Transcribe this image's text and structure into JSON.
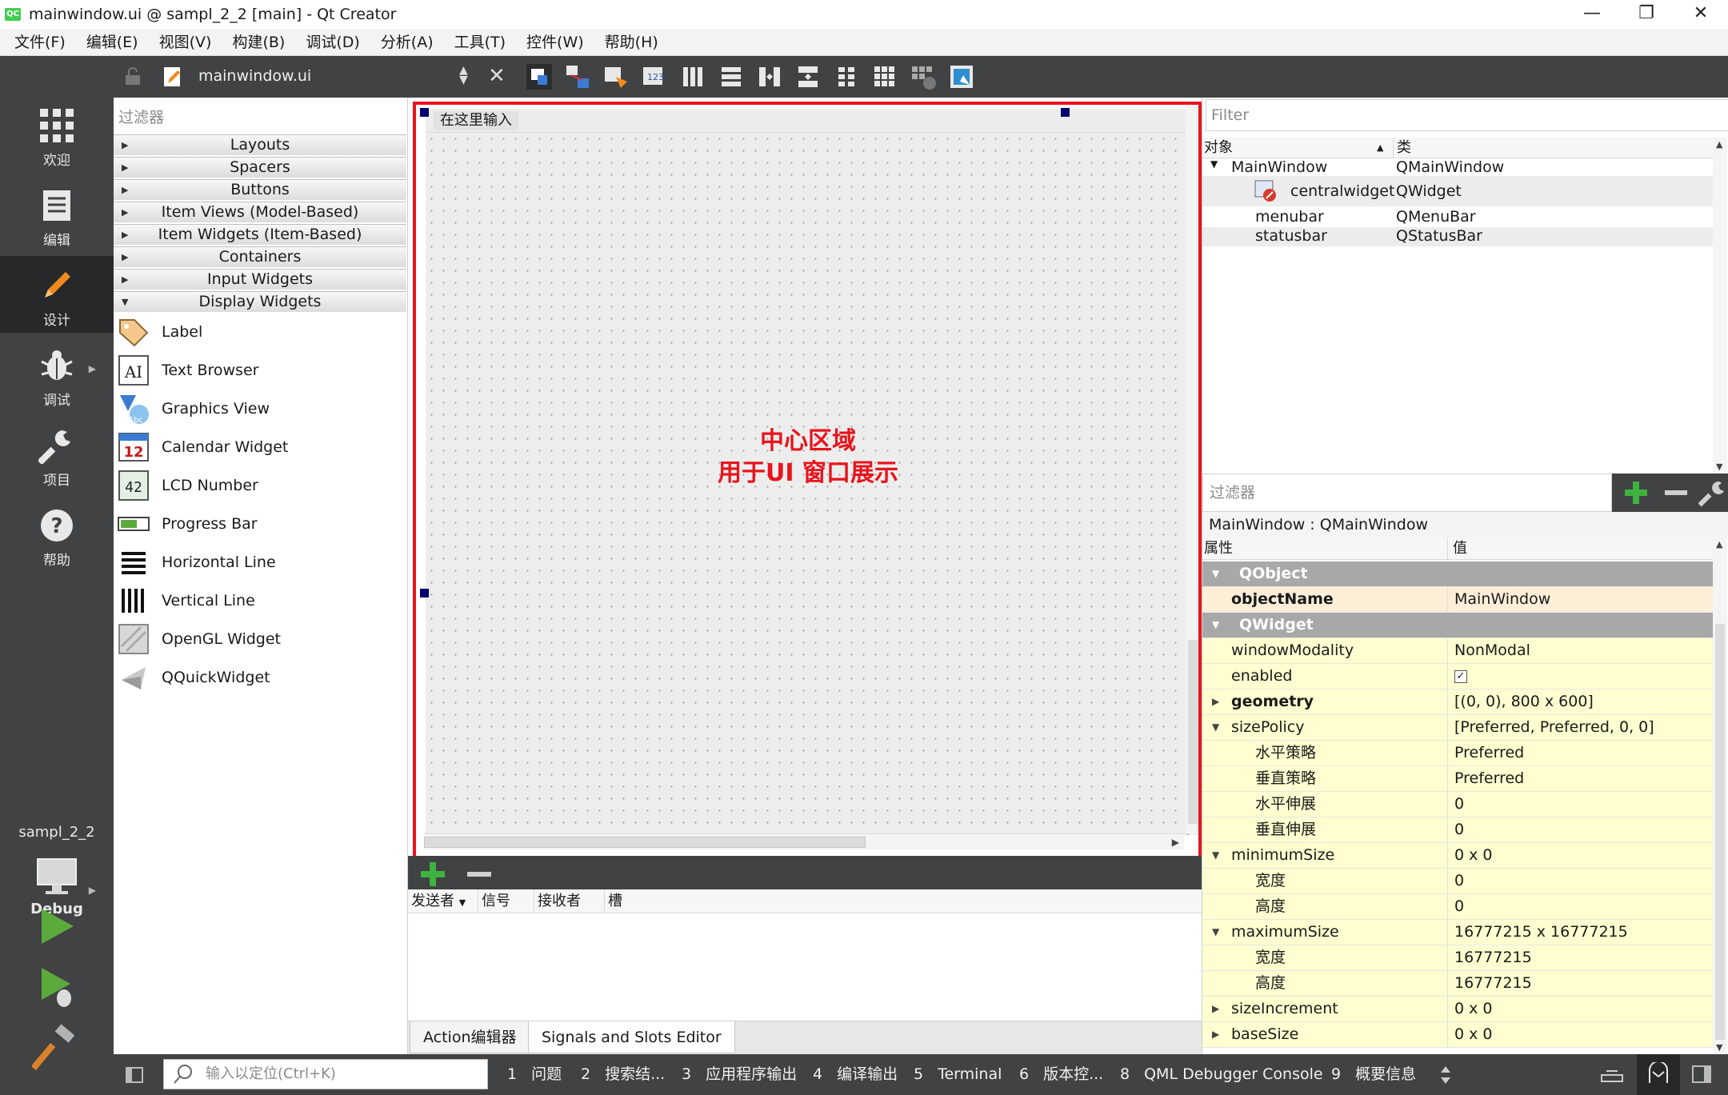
{
  "window": {
    "title": "mainwindow.ui @ sampl_2_2 [main] - Qt Creator",
    "app_badge": "QC",
    "controls": {
      "minimize": "—",
      "maximize": "❐",
      "close": "✕"
    }
  },
  "menubar": [
    "文件(F)",
    "编辑(E)",
    "视图(V)",
    "构建(B)",
    "调试(D)",
    "分析(A)",
    "工具(T)",
    "控件(W)",
    "帮助(H)"
  ],
  "modes": [
    {
      "label": "欢迎",
      "icon": "grid-icon"
    },
    {
      "label": "编辑",
      "icon": "document-icon"
    },
    {
      "label": "设计",
      "icon": "pencil-icon",
      "active": true
    },
    {
      "label": "调试",
      "icon": "bug-icon"
    },
    {
      "label": "项目",
      "icon": "wrench-icon"
    },
    {
      "label": "帮助",
      "icon": "help-icon"
    }
  ],
  "kit": {
    "project": "sampl_2_2",
    "config": "Debug"
  },
  "editor_toolbar": {
    "document": "mainwindow.ui"
  },
  "widget_box": {
    "filter_placeholder": "过滤器",
    "categories": [
      "Layouts",
      "Spacers",
      "Buttons",
      "Item Views (Model-Based)",
      "Item Widgets (Item-Based)",
      "Containers",
      "Input Widgets",
      "Display Widgets"
    ],
    "items": [
      {
        "label": "Label",
        "icon": "label-tag-icon"
      },
      {
        "label": "Text Browser",
        "icon": "text-browser-icon"
      },
      {
        "label": "Graphics View",
        "icon": "graphics-view-icon"
      },
      {
        "label": "Calendar Widget",
        "icon": "calendar-icon"
      },
      {
        "label": "LCD Number",
        "icon": "lcd-number-icon"
      },
      {
        "label": "Progress Bar",
        "icon": "progress-bar-icon"
      },
      {
        "label": "Horizontal Line",
        "icon": "horizontal-line-icon"
      },
      {
        "label": "Vertical Line",
        "icon": "vertical-line-icon"
      },
      {
        "label": "OpenGL Widget",
        "icon": "opengl-icon"
      },
      {
        "label": "QQuickWidget",
        "icon": "quick-widget-icon"
      }
    ]
  },
  "form": {
    "menu_placeholder": "在这里输入",
    "annotation_line1": "中心区域",
    "annotation_line2": "用于UI 窗口展示"
  },
  "signals_slots": {
    "columns": [
      "发送者",
      "信号",
      "接收者",
      "槽"
    ],
    "tabs": [
      "Action编辑器",
      "Signals and Slots Editor"
    ]
  },
  "object_inspector": {
    "filter_placeholder": "Filter",
    "columns": [
      "对象",
      "类"
    ],
    "rows": [
      {
        "object": "MainWindow",
        "class": "QMainWindow"
      },
      {
        "object": "centralwidget",
        "class": "QWidget"
      },
      {
        "object": "menubar",
        "class": "QMenuBar"
      },
      {
        "object": "statusbar",
        "class": "QStatusBar"
      }
    ]
  },
  "property_editor": {
    "filter_placeholder": "过滤器",
    "class_line": "MainWindow : QMainWindow",
    "columns": [
      "属性",
      "值"
    ],
    "rows": [
      {
        "name": "QObject",
        "value": ""
      },
      {
        "name": "objectName",
        "value": "MainWindow"
      },
      {
        "name": "QWidget",
        "value": ""
      },
      {
        "name": "windowModality",
        "value": "NonModal"
      },
      {
        "name": "enabled",
        "value": "✓"
      },
      {
        "name": "geometry",
        "value": "[(0, 0), 800 x 600]"
      },
      {
        "name": "sizePolicy",
        "value": "[Preferred, Preferred, 0, 0]"
      },
      {
        "name": "水平策略",
        "value": "Preferred"
      },
      {
        "name": "垂直策略",
        "value": "Preferred"
      },
      {
        "name": "水平伸展",
        "value": "0"
      },
      {
        "name": "垂直伸展",
        "value": "0"
      },
      {
        "name": "minimumSize",
        "value": "0 x 0"
      },
      {
        "name": "宽度",
        "value": "0"
      },
      {
        "name": "高度",
        "value": "0"
      },
      {
        "name": "maximumSize",
        "value": "16777215 x 16777215"
      },
      {
        "name": "宽度",
        "value": "16777215"
      },
      {
        "name": "高度",
        "value": "16777215"
      },
      {
        "name": "sizeIncrement",
        "value": "0 x 0"
      },
      {
        "name": "baseSize",
        "value": "0 x 0"
      }
    ]
  },
  "statusbar": {
    "locator_placeholder": "输入以定位(Ctrl+K)",
    "tabs": [
      {
        "num": "1",
        "label": "问题"
      },
      {
        "num": "2",
        "label": "搜索结..."
      },
      {
        "num": "3",
        "label": "应用程序输出"
      },
      {
        "num": "4",
        "label": "编译输出"
      },
      {
        "num": "5",
        "label": "Terminal"
      },
      {
        "num": "6",
        "label": "版本控..."
      },
      {
        "num": "8",
        "label": "QML Debugger Console"
      },
      {
        "num": "9",
        "label": "概要信息"
      }
    ]
  },
  "colors": {
    "accent_red": "#e8141c",
    "dark_panel": "#404244",
    "active_mode": "#262829",
    "property_yellow": "#fefed0"
  }
}
